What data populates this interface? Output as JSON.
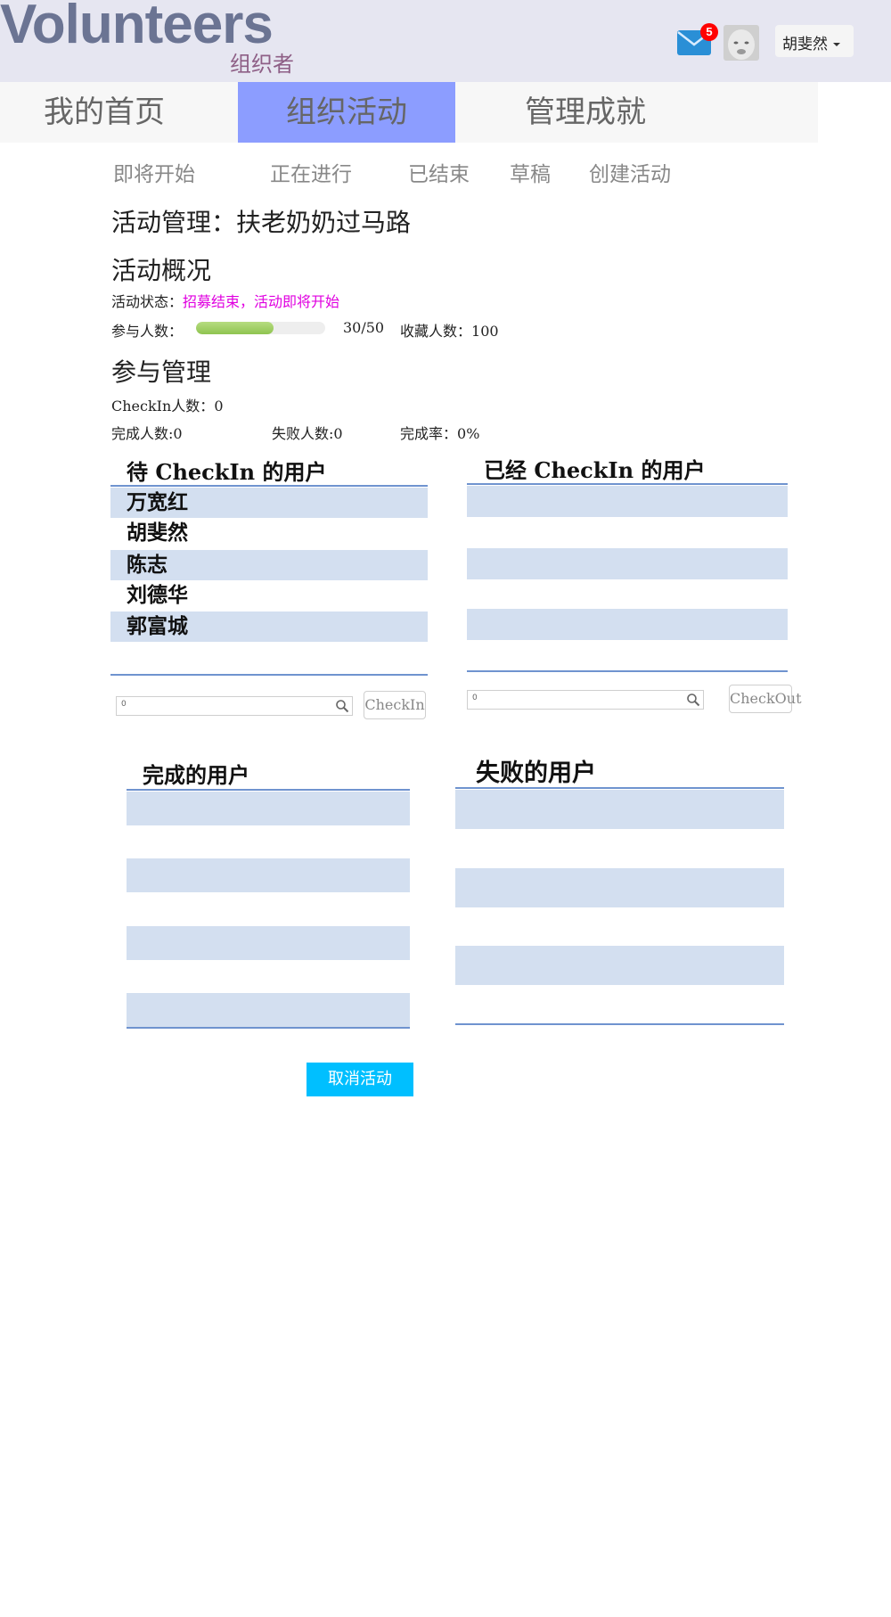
{
  "header": {
    "logo": "Volunteers",
    "role": "组织者",
    "mail_count": "5",
    "user_name": "胡斐然"
  },
  "main_nav": {
    "tabs": [
      "我的首页",
      "组织活动",
      "管理成就"
    ],
    "active_tab": "组织活动"
  },
  "sub_nav": {
    "items": [
      "即将开始",
      "正在进行",
      "已结束",
      "草稿",
      "创建活动"
    ]
  },
  "page": {
    "title": "活动管理：扶老奶奶过马路"
  },
  "overview": {
    "heading": "活动概况",
    "status_label": "活动状态：",
    "status_value": "招募结束，活动即将开始",
    "participants_label": "参与人数：",
    "participants_progress": 0.6,
    "participants_value": "30/50",
    "favorites_label": "收藏人数：",
    "favorites_value": "100"
  },
  "management": {
    "heading": "参与管理",
    "checkin_count_label": "CheckIn人数：",
    "checkin_count_value": "0",
    "completed_label": "完成人数:",
    "completed_value": "0",
    "failed_label": "失败人数:",
    "failed_value": "0",
    "rate_label": "完成率：",
    "rate_value": "0%"
  },
  "lists": {
    "pending_checkin": {
      "title": "待 CheckIn 的用户",
      "users": [
        "万宽红",
        "胡斐然",
        "陈志",
        "刘德华",
        "郭富城"
      ],
      "search_value": "0",
      "button": "CheckIn"
    },
    "checked_in": {
      "title": "已经 CheckIn 的用户",
      "search_value": "0",
      "button": "CheckOut"
    },
    "completed": {
      "title": "完成的用户"
    },
    "failed": {
      "title": "失败的用户"
    }
  },
  "actions": {
    "cancel": "取消活动"
  },
  "colors": {
    "header_bg": "#e6e6f1",
    "logo": "#6b7493",
    "active_tab": "#8c9dff",
    "status": "#e000e0",
    "list_stripe": "#d3dff0",
    "list_line": "#6f93cf",
    "cancel_button": "#00bfff"
  }
}
